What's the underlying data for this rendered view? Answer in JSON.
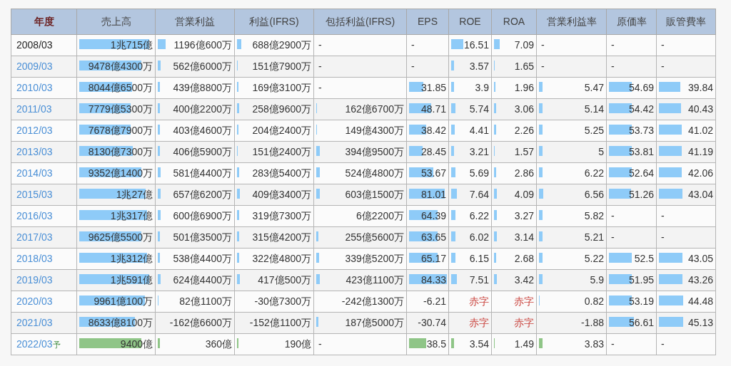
{
  "table": {
    "columns": [
      {
        "label": "年度",
        "selected": true
      },
      {
        "label": "売上高",
        "selected": false
      },
      {
        "label": "営業利益",
        "selected": false
      },
      {
        "label": "利益(IFRS)",
        "selected": false
      },
      {
        "label": "包括利益(IFRS)",
        "selected": false
      },
      {
        "label": "EPS",
        "selected": false
      },
      {
        "label": "ROE",
        "selected": false
      },
      {
        "label": "ROA",
        "selected": false
      },
      {
        "label": "営業利益率",
        "selected": false
      },
      {
        "label": "原価率",
        "selected": false
      },
      {
        "label": "販管費率",
        "selected": false
      }
    ],
    "rows": [
      {
        "forecast": false,
        "cells": [
          {
            "kind": "year",
            "text": "2008/03",
            "link": false
          },
          {
            "kind": "bar",
            "text": "1兆715億",
            "level": 0.9
          },
          {
            "kind": "bar",
            "text": "1196億600万",
            "level": 0.1
          },
          {
            "kind": "bar",
            "text": "688億2900万",
            "level": 0.05
          },
          {
            "kind": "dash",
            "text": "-"
          },
          {
            "kind": "dash",
            "text": "-"
          },
          {
            "kind": "bar",
            "text": "16.51",
            "level": 0.28
          },
          {
            "kind": "bar",
            "text": "7.09",
            "level": 0.13
          },
          {
            "kind": "dash",
            "text": "-"
          },
          {
            "kind": "dash",
            "text": "-"
          },
          {
            "kind": "dash",
            "text": "-"
          }
        ]
      },
      {
        "forecast": false,
        "cells": [
          {
            "kind": "year",
            "text": "2009/03",
            "link": true
          },
          {
            "kind": "bar",
            "text": "9478億4300万",
            "level": 0.8
          },
          {
            "kind": "bar",
            "text": "562億6000万",
            "level": 0.04
          },
          {
            "kind": "bar",
            "text": "151億7900万",
            "level": 0.01
          },
          {
            "kind": "dash",
            "text": "-"
          },
          {
            "kind": "dash",
            "text": "-"
          },
          {
            "kind": "bar",
            "text": "3.57",
            "level": 0.06
          },
          {
            "kind": "bar",
            "text": "1.65",
            "level": 0.02
          },
          {
            "kind": "dash",
            "text": "-"
          },
          {
            "kind": "dash",
            "text": "-"
          },
          {
            "kind": "dash",
            "text": "-"
          }
        ]
      },
      {
        "forecast": false,
        "cells": [
          {
            "kind": "year",
            "text": "2010/03",
            "link": true
          },
          {
            "kind": "bar",
            "text": "8044億6500万",
            "level": 0.68
          },
          {
            "kind": "bar",
            "text": "439億8800万",
            "level": 0.03
          },
          {
            "kind": "bar",
            "text": "169億3100万",
            "level": 0.02
          },
          {
            "kind": "dash",
            "text": "-"
          },
          {
            "kind": "bar",
            "text": "31.85",
            "level": 0.34
          },
          {
            "kind": "bar",
            "text": "3.9",
            "level": 0.07
          },
          {
            "kind": "bar",
            "text": "1.96",
            "level": 0.03
          },
          {
            "kind": "bar",
            "text": "5.47",
            "level": 0.05
          },
          {
            "kind": "bar",
            "text": "54.69",
            "level": 0.47
          },
          {
            "kind": "bar",
            "text": "39.84",
            "level": 0.37
          }
        ]
      },
      {
        "forecast": false,
        "cells": [
          {
            "kind": "year",
            "text": "2011/03",
            "link": true
          },
          {
            "kind": "bar",
            "text": "7779億5300万",
            "level": 0.66
          },
          {
            "kind": "bar",
            "text": "400億2200万",
            "level": 0.03
          },
          {
            "kind": "bar",
            "text": "258億9600万",
            "level": 0.03
          },
          {
            "kind": "bar",
            "text": "162億6700万",
            "level": 0.01
          },
          {
            "kind": "bar",
            "text": "48.71",
            "level": 0.54
          },
          {
            "kind": "bar",
            "text": "5.74",
            "level": 0.1
          },
          {
            "kind": "bar",
            "text": "3.06",
            "level": 0.05
          },
          {
            "kind": "bar",
            "text": "5.14",
            "level": 0.05
          },
          {
            "kind": "bar",
            "text": "54.42",
            "level": 0.47
          },
          {
            "kind": "bar",
            "text": "40.43",
            "level": 0.38
          }
        ]
      },
      {
        "forecast": false,
        "cells": [
          {
            "kind": "year",
            "text": "2012/03",
            "link": true
          },
          {
            "kind": "bar",
            "text": "7678億7900万",
            "level": 0.66
          },
          {
            "kind": "bar",
            "text": "403億4600万",
            "level": 0.03
          },
          {
            "kind": "bar",
            "text": "204億2400万",
            "level": 0.02
          },
          {
            "kind": "bar",
            "text": "149億4300万",
            "level": 0.01
          },
          {
            "kind": "bar",
            "text": "38.42",
            "level": 0.42
          },
          {
            "kind": "bar",
            "text": "4.41",
            "level": 0.09
          },
          {
            "kind": "bar",
            "text": "2.26",
            "level": 0.05
          },
          {
            "kind": "bar",
            "text": "5.25",
            "level": 0.05
          },
          {
            "kind": "bar",
            "text": "53.73",
            "level": 0.47
          },
          {
            "kind": "bar",
            "text": "41.02",
            "level": 0.39
          }
        ]
      },
      {
        "forecast": false,
        "cells": [
          {
            "kind": "year",
            "text": "2013/03",
            "link": true
          },
          {
            "kind": "bar",
            "text": "8130億7300万",
            "level": 0.69
          },
          {
            "kind": "bar",
            "text": "406億5900万",
            "level": 0.03
          },
          {
            "kind": "bar",
            "text": "151億2400万",
            "level": 0.01
          },
          {
            "kind": "bar",
            "text": "394億9500万",
            "level": 0.04
          },
          {
            "kind": "bar",
            "text": "28.45",
            "level": 0.32
          },
          {
            "kind": "bar",
            "text": "3.21",
            "level": 0.06
          },
          {
            "kind": "bar",
            "text": "1.57",
            "level": 0.02
          },
          {
            "kind": "bar",
            "text": "5",
            "level": 0.05
          },
          {
            "kind": "bar",
            "text": "53.81",
            "level": 0.47
          },
          {
            "kind": "bar",
            "text": "41.19",
            "level": 0.39
          }
        ]
      },
      {
        "forecast": false,
        "cells": [
          {
            "kind": "year",
            "text": "2014/03",
            "link": true
          },
          {
            "kind": "bar",
            "text": "9352億1400万",
            "level": 0.8
          },
          {
            "kind": "bar",
            "text": "581億4400万",
            "level": 0.04
          },
          {
            "kind": "bar",
            "text": "283億5400万",
            "level": 0.03
          },
          {
            "kind": "bar",
            "text": "524億4800万",
            "level": 0.04
          },
          {
            "kind": "bar",
            "text": "53.67",
            "level": 0.58
          },
          {
            "kind": "bar",
            "text": "5.69",
            "level": 0.1
          },
          {
            "kind": "bar",
            "text": "2.86",
            "level": 0.05
          },
          {
            "kind": "bar",
            "text": "6.22",
            "level": 0.05
          },
          {
            "kind": "bar",
            "text": "52.64",
            "level": 0.46
          },
          {
            "kind": "bar",
            "text": "42.06",
            "level": 0.39
          }
        ]
      },
      {
        "forecast": false,
        "cells": [
          {
            "kind": "year",
            "text": "2015/03",
            "link": true
          },
          {
            "kind": "bar",
            "text": "1兆27億",
            "level": 0.85
          },
          {
            "kind": "bar",
            "text": "657億6200万",
            "level": 0.04
          },
          {
            "kind": "bar",
            "text": "409億3400万",
            "level": 0.04
          },
          {
            "kind": "bar",
            "text": "603億1500万",
            "level": 0.04
          },
          {
            "kind": "bar",
            "text": "81.01",
            "level": 0.86
          },
          {
            "kind": "bar",
            "text": "7.64",
            "level": 0.14
          },
          {
            "kind": "bar",
            "text": "4.09",
            "level": 0.07
          },
          {
            "kind": "bar",
            "text": "6.56",
            "level": 0.06
          },
          {
            "kind": "bar",
            "text": "51.26",
            "level": 0.45
          },
          {
            "kind": "bar",
            "text": "43.04",
            "level": 0.4
          }
        ]
      },
      {
        "forecast": false,
        "cells": [
          {
            "kind": "year",
            "text": "2016/03",
            "link": true
          },
          {
            "kind": "bar",
            "text": "1兆317億",
            "level": 0.87
          },
          {
            "kind": "bar",
            "text": "600億6900万",
            "level": 0.04
          },
          {
            "kind": "bar",
            "text": "319億7300万",
            "level": 0.03
          },
          {
            "kind": "plain",
            "text": "6億2200万"
          },
          {
            "kind": "bar",
            "text": "64.39",
            "level": 0.69
          },
          {
            "kind": "bar",
            "text": "6.22",
            "level": 0.11
          },
          {
            "kind": "bar",
            "text": "3.27",
            "level": 0.06
          },
          {
            "kind": "bar",
            "text": "5.82",
            "level": 0.05
          },
          {
            "kind": "dash",
            "text": "-"
          },
          {
            "kind": "dash",
            "text": "-"
          }
        ]
      },
      {
        "forecast": false,
        "cells": [
          {
            "kind": "year",
            "text": "2017/03",
            "link": true
          },
          {
            "kind": "bar",
            "text": "9625億5500万",
            "level": 0.8
          },
          {
            "kind": "bar",
            "text": "501億3500万",
            "level": 0.03
          },
          {
            "kind": "bar",
            "text": "315億4200万",
            "level": 0.03
          },
          {
            "kind": "bar",
            "text": "255億5600万",
            "level": 0.02
          },
          {
            "kind": "bar",
            "text": "63.65",
            "level": 0.69
          },
          {
            "kind": "bar",
            "text": "6.02",
            "level": 0.11
          },
          {
            "kind": "bar",
            "text": "3.14",
            "level": 0.06
          },
          {
            "kind": "bar",
            "text": "5.21",
            "level": 0.05
          },
          {
            "kind": "dash",
            "text": "-"
          },
          {
            "kind": "dash",
            "text": "-"
          }
        ]
      },
      {
        "forecast": false,
        "cells": [
          {
            "kind": "year",
            "text": "2018/03",
            "link": true
          },
          {
            "kind": "bar",
            "text": "1兆312億",
            "level": 0.87
          },
          {
            "kind": "bar",
            "text": "538億4400万",
            "level": 0.03
          },
          {
            "kind": "bar",
            "text": "322億4800万",
            "level": 0.03
          },
          {
            "kind": "bar",
            "text": "339億5200万",
            "level": 0.03
          },
          {
            "kind": "bar",
            "text": "65.17",
            "level": 0.69
          },
          {
            "kind": "bar",
            "text": "6.15",
            "level": 0.11
          },
          {
            "kind": "bar",
            "text": "2.68",
            "level": 0.05
          },
          {
            "kind": "bar",
            "text": "5.22",
            "level": 0.05
          },
          {
            "kind": "bar",
            "text": "52.5",
            "level": 0.46
          },
          {
            "kind": "bar",
            "text": "43.05",
            "level": 0.4
          }
        ]
      },
      {
        "forecast": false,
        "cells": [
          {
            "kind": "year",
            "text": "2019/03",
            "link": true
          },
          {
            "kind": "bar",
            "text": "1兆591億",
            "level": 0.9
          },
          {
            "kind": "bar",
            "text": "624億4400万",
            "level": 0.04
          },
          {
            "kind": "bar",
            "text": "417億500万",
            "level": 0.04
          },
          {
            "kind": "bar",
            "text": "423億1100万",
            "level": 0.04
          },
          {
            "kind": "bar",
            "text": "84.33",
            "level": 0.92
          },
          {
            "kind": "bar",
            "text": "7.51",
            "level": 0.14
          },
          {
            "kind": "bar",
            "text": "3.42",
            "level": 0.06
          },
          {
            "kind": "bar",
            "text": "5.9",
            "level": 0.05
          },
          {
            "kind": "bar",
            "text": "51.95",
            "level": 0.46
          },
          {
            "kind": "bar",
            "text": "43.26",
            "level": 0.4
          }
        ]
      },
      {
        "forecast": false,
        "cells": [
          {
            "kind": "year",
            "text": "2020/03",
            "link": true
          },
          {
            "kind": "bar",
            "text": "9961億100万",
            "level": 0.84
          },
          {
            "kind": "bar",
            "text": "82億1100万",
            "level": 0.01
          },
          {
            "kind": "plain",
            "text": "-30億7300万"
          },
          {
            "kind": "plain",
            "text": "-242億1300万"
          },
          {
            "kind": "plain",
            "text": "-6.21"
          },
          {
            "kind": "deficit",
            "text": "赤字"
          },
          {
            "kind": "deficit",
            "text": "赤字"
          },
          {
            "kind": "bar",
            "text": "0.82",
            "level": 0.01
          },
          {
            "kind": "bar",
            "text": "53.19",
            "level": 0.46
          },
          {
            "kind": "bar",
            "text": "44.48",
            "level": 0.41
          }
        ]
      },
      {
        "forecast": false,
        "cells": [
          {
            "kind": "year",
            "text": "2021/03",
            "link": true
          },
          {
            "kind": "bar",
            "text": "8633億8100万",
            "level": 0.72
          },
          {
            "kind": "plain",
            "text": "-162億6600万"
          },
          {
            "kind": "plain",
            "text": "-152億1100万"
          },
          {
            "kind": "bar",
            "text": "187億5000万",
            "level": 0.02
          },
          {
            "kind": "plain",
            "text": "-30.74"
          },
          {
            "kind": "deficit",
            "text": "赤字"
          },
          {
            "kind": "deficit",
            "text": "赤字"
          },
          {
            "kind": "plain",
            "text": "-1.88"
          },
          {
            "kind": "bar",
            "text": "56.61",
            "level": 0.5
          },
          {
            "kind": "bar",
            "text": "45.13",
            "level": 0.41
          }
        ]
      },
      {
        "forecast": true,
        "cells": [
          {
            "kind": "year",
            "text": "2022/03",
            "link": true,
            "mark": "予"
          },
          {
            "kind": "bar",
            "text": "9400億",
            "level": 0.8
          },
          {
            "kind": "bar",
            "text": "360億",
            "level": 0.03
          },
          {
            "kind": "bar",
            "text": "190億",
            "level": 0.02
          },
          {
            "kind": "dash",
            "text": "-"
          },
          {
            "kind": "bar",
            "text": "38.5",
            "level": 0.42
          },
          {
            "kind": "bar",
            "text": "3.54",
            "level": 0.06
          },
          {
            "kind": "bar",
            "text": "1.49",
            "level": 0.02
          },
          {
            "kind": "bar",
            "text": "3.83",
            "level": 0.05
          },
          {
            "kind": "dash",
            "text": "-"
          },
          {
            "kind": "dash",
            "text": "-"
          }
        ]
      }
    ]
  }
}
